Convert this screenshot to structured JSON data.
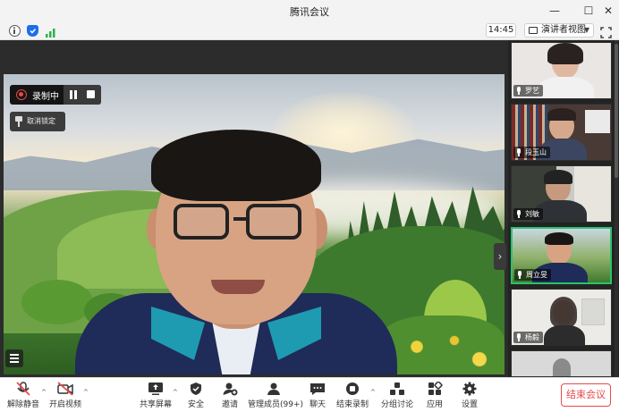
{
  "window": {
    "title": "腾讯会议"
  },
  "infobar": {
    "time": "14:45",
    "view_mode": "演讲者视图"
  },
  "recording": {
    "status": "录制中",
    "unlock_label": "取消锁定"
  },
  "participants": [
    {
      "name": "罗艺",
      "muted": false
    },
    {
      "name": "段玉山",
      "muted": false
    },
    {
      "name": "刘敏",
      "muted": false
    },
    {
      "name": "周立旻",
      "muted": false,
      "active": true
    },
    {
      "name": "杨毅",
      "muted": false
    }
  ],
  "toolbar": {
    "unmute": "解除静音",
    "start_video": "开启视频",
    "share_screen": "共享屏幕",
    "security": "安全",
    "invite": "邀请",
    "manage_members": "管理成员(99+)",
    "chat": "聊天",
    "end_recording": "结束录制",
    "breakout": "分组讨论",
    "apps": "应用",
    "settings": "设置",
    "end_meeting": "结束会议"
  },
  "colors": {
    "accent_green": "#27c46b",
    "end_red": "#e8494a",
    "rec_red": "#e14a4a"
  }
}
